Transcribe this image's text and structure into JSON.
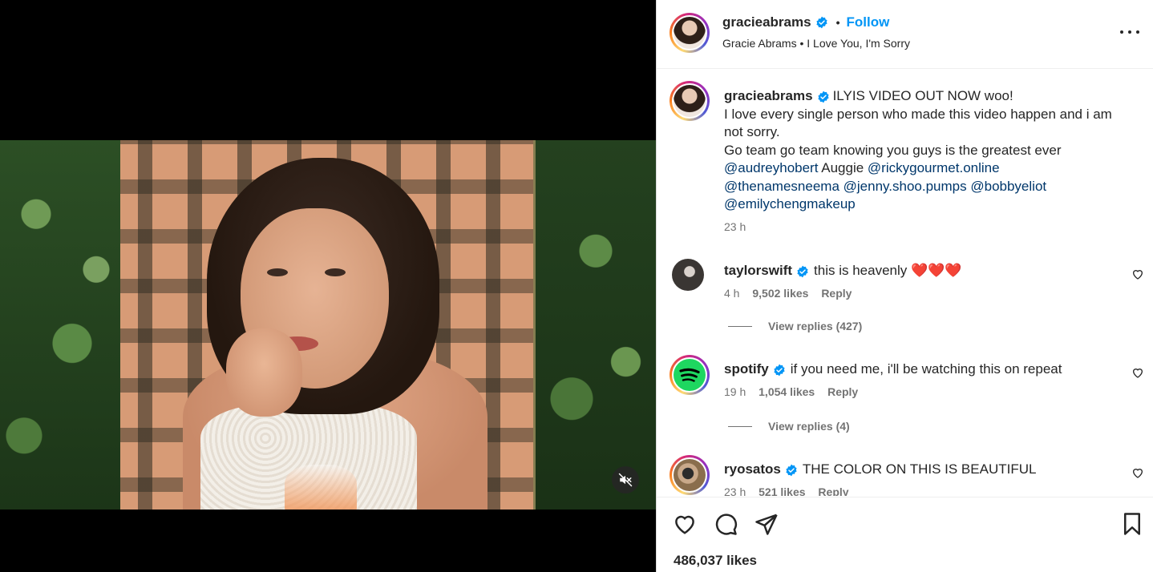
{
  "header": {
    "username": "gracieabrams",
    "separator": "•",
    "follow_label": "Follow",
    "subtitle": "Gracie Abrams • I Love You, I'm Sorry"
  },
  "caption": {
    "username": "gracieabrams",
    "line1": "ILYIS VIDEO OUT NOW woo!",
    "line2": "I love every single person who made this video happen and i am not sorry.",
    "line3": "Go team go team knowing you guys is the greatest ever",
    "mention1": "@audreyhobert",
    "plain1": "Auggie",
    "mention2": "@rickygourmet.online",
    "mention3": "@thenamesneema",
    "mention4": "@jenny.shoo.pumps",
    "mention5": "@bobbyeliot",
    "mention6": "@emilychengmakeup",
    "time": "23 h"
  },
  "comments": [
    {
      "username": "taylorswift",
      "text": "this is heavenly ❤️❤️❤️",
      "time": "4 h",
      "likes": "9,502 likes",
      "reply": "Reply",
      "view_replies": "View replies (427)"
    },
    {
      "username": "spotify",
      "text": "if you need me, i'll be watching this on repeat",
      "time": "19 h",
      "likes": "1,054 likes",
      "reply": "Reply",
      "view_replies": "View replies (4)"
    },
    {
      "username": "ryosatos",
      "text": "THE COLOR ON THIS IS BEAUTIFUL",
      "time": "23 h",
      "likes": "521 likes",
      "reply": "Reply"
    }
  ],
  "footer": {
    "likes_total": "486,037 likes"
  },
  "colors": {
    "accent": "#0095f6",
    "mention": "#00376b",
    "muted": "#737373",
    "verified": "#0095f6",
    "spotify": "#1ed760"
  },
  "icons": {
    "mute": "speaker-muted-icon",
    "more": "more-options-icon",
    "like": "heart-icon",
    "comment": "comment-icon",
    "share": "send-icon",
    "save": "bookmark-icon"
  }
}
